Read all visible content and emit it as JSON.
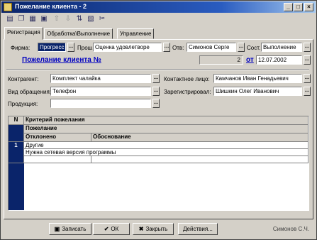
{
  "window": {
    "title": "Пожелание клиента - 2"
  },
  "toolbar": {
    "icons": [
      "new-icon",
      "copy-icon",
      "delete-icon",
      "properties-icon",
      "move-up-icon",
      "move-down-icon",
      "sort-icon",
      "filter-icon",
      "tools-icon"
    ]
  },
  "tabs": [
    "Регистрация",
    "Обработка\\Выполнение",
    "Управление"
  ],
  "form": {
    "firm_label": "Фирма:",
    "firm_value": "Прогресс",
    "reason_label": "Прош.",
    "reason_value": "Оценка удовлетворе",
    "resp_label": "Отв:",
    "resp_value": "Симонов Серге",
    "state_label": "Сост.",
    "state_value": "Выполнение",
    "doc_link": "Пожелание клиента №",
    "doc_number": "2",
    "date_link": "от",
    "date_value": "12.07.2002",
    "contractor_label": "Контрагент:",
    "contractor_value": "Комплект чалайка",
    "contact_label": "Контактное лицо:",
    "contact_value": "Камчанов Иван Генадьевич",
    "appeal_label": "Вид обращения:",
    "appeal_value": "Телефон",
    "registered_label": "Зарегистрировал:",
    "registered_value": "Шишкин Олег Иванович",
    "product_label": "Продукция:",
    "product_value": ""
  },
  "grid": {
    "num_header": "N",
    "headers": [
      "Критерий пожелания",
      "Пожелание",
      "Отклонено",
      "Обоснование"
    ],
    "rows": [
      {
        "num": "1",
        "criterion": "Другие",
        "wish": "Нужна сетевая версия программы"
      }
    ]
  },
  "buttons": {
    "write": "Записать",
    "ok": "ОК",
    "close": "Закрыть",
    "actions": "Действия..."
  },
  "status": "Симонов С.Ч."
}
